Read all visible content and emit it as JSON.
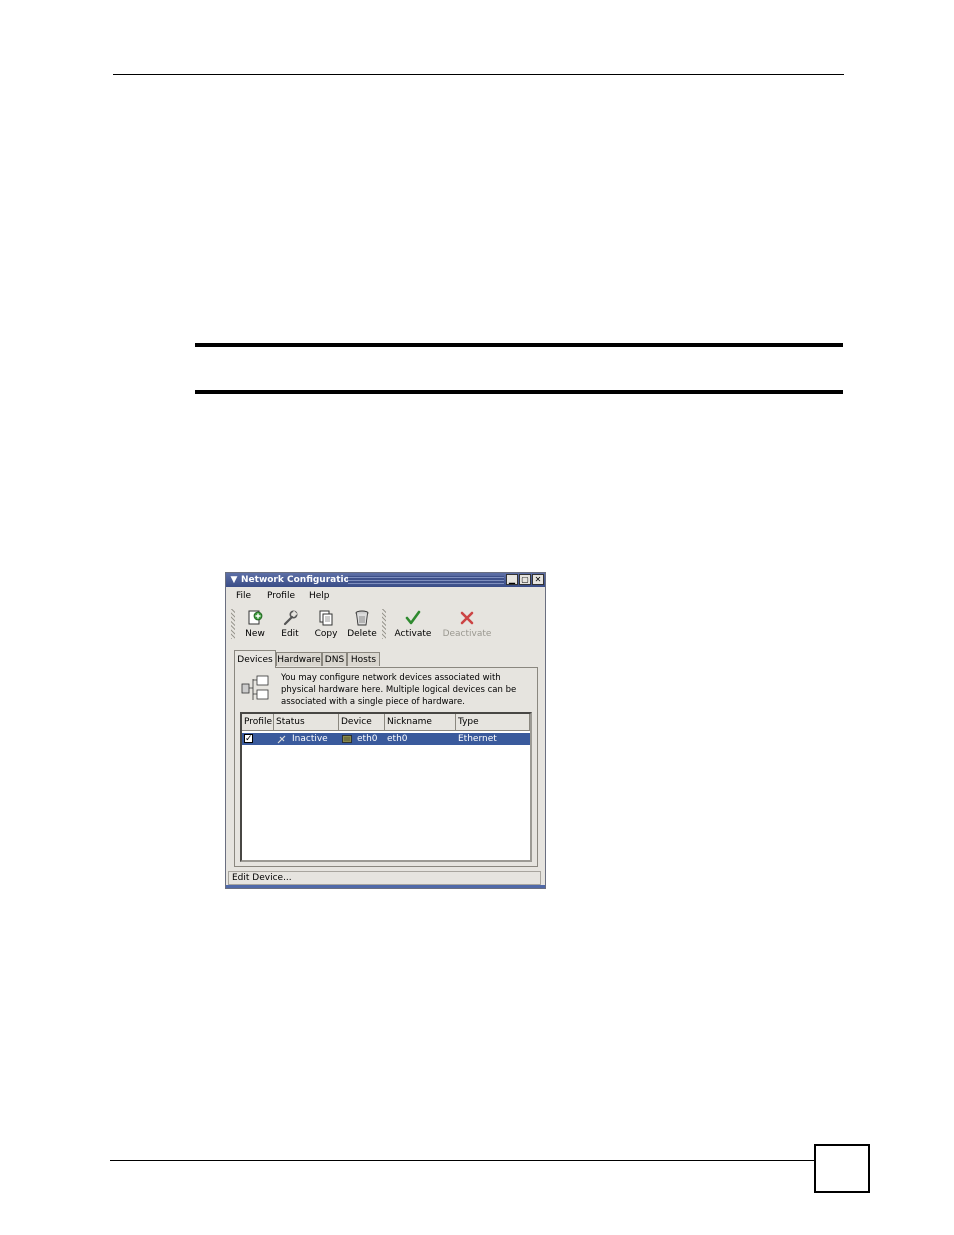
{
  "window": {
    "title": "Network Configuration",
    "buttons": {
      "minimize": "▁",
      "maximize": "▢",
      "close": "✕"
    }
  },
  "menubar": [
    {
      "label": "File"
    },
    {
      "label": "Profile"
    },
    {
      "label": "Help"
    }
  ],
  "toolbar": {
    "new": "New",
    "edit": "Edit",
    "copy": "Copy",
    "delete": "Delete",
    "activate": "Activate",
    "deactivate": "Deactivate"
  },
  "tabs": [
    "Devices",
    "Hardware",
    "DNS",
    "Hosts"
  ],
  "info": {
    "line1": "You may configure network devices associated with",
    "line2": "physical hardware here.  Multiple logical devices can be",
    "line3": "associated with a single piece of hardware."
  },
  "table": {
    "columns": [
      "Profile",
      "Status",
      "Device",
      "Nickname",
      "Type"
    ],
    "rows": [
      {
        "profile_checked": true,
        "status": "Inactive",
        "device": "eth0",
        "nickname": "eth0",
        "type": "Ethernet"
      }
    ]
  },
  "statusbar": "Edit Device...",
  "colors": {
    "titlebar": "#3a4d87",
    "selection": "#3a5a9c",
    "window_bg": "#e6e4df"
  }
}
